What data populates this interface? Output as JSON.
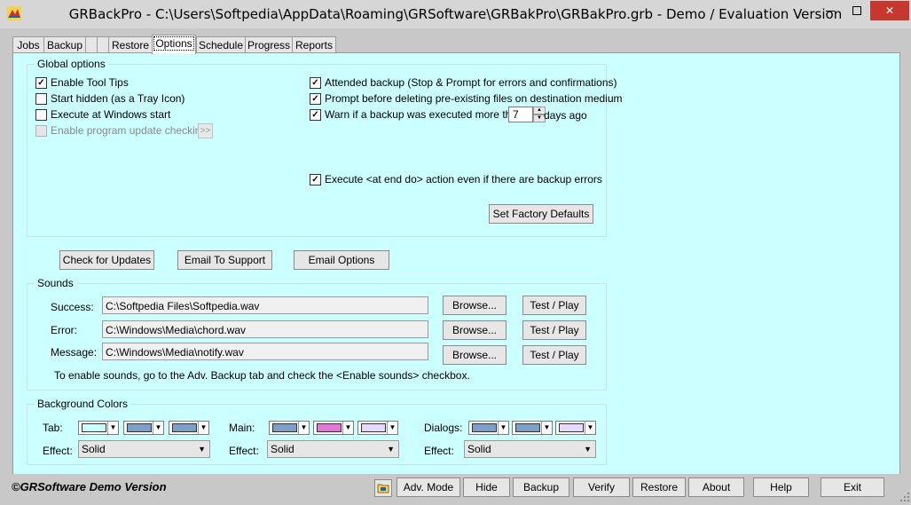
{
  "window": {
    "title": "GRBackPro - C:\\Users\\Softpedia\\AppData\\Roaming\\GRSoftware\\GRBakPro\\GRBakPro.grb - Demo / Evaluation Version",
    "minimize_icon": "minimize-icon",
    "maximize_icon": "maximize-icon",
    "close_glyph": "✕"
  },
  "tabs": [
    "Jobs",
    "Backup",
    "",
    "Restore",
    "Options",
    "Schedule",
    "Progress",
    "Reports"
  ],
  "global_options": {
    "label": "Global options",
    "enable_tool_tips": {
      "label": "Enable Tool Tips",
      "checked": true
    },
    "start_hidden": {
      "label": "Start hidden (as a Tray Icon)",
      "checked": false
    },
    "execute_at_start": {
      "label": "Execute at Windows start",
      "checked": false
    },
    "enable_update_check": {
      "label": "Enable program update checking",
      "checked": false,
      "disabled": true
    },
    "update_more": ">>",
    "attended_backup": {
      "label": "Attended backup (Stop & Prompt for errors and confirmations)",
      "checked": true
    },
    "prompt_delete": {
      "label": "Prompt before deleting pre-existing files on destination medium",
      "checked": true
    },
    "warn_backup": {
      "label": "Warn if a backup was executed more than",
      "checked": true
    },
    "warn_days_value": "7",
    "warn_days_suffix": "days ago",
    "execute_at_end": {
      "label": "Execute <at end do> action even if there are backup errors",
      "checked": true
    },
    "factory_defaults": "Set Factory Defaults"
  },
  "actions": {
    "check_updates": "Check for Updates",
    "email_support": "Email To Support",
    "email_options": "Email Options"
  },
  "sounds": {
    "label": "Sounds",
    "rows": [
      {
        "label": "Success:",
        "path": "C:\\Softpedia Files\\Softpedia.wav",
        "browse": "Browse...",
        "test": "Test / Play"
      },
      {
        "label": "Error:",
        "path": "C:\\Windows\\Media\\chord.wav",
        "browse": "Browse...",
        "test": "Test / Play"
      },
      {
        "label": "Message:",
        "path": "C:\\Windows\\Media\\notify.wav",
        "browse": "Browse...",
        "test": "Test / Play"
      }
    ],
    "hint": "To enable sounds, go to the Adv. Backup tab and check the <Enable sounds> checkbox."
  },
  "background_colors": {
    "label": "Background Colors",
    "tab_label": "Tab:",
    "main_label": "Main:",
    "dialogs_label": "Dialogs:",
    "effect_label": "Effect:",
    "effect_value": "Solid",
    "tab_colors": [
      "#ccffff",
      "#7b9fc8",
      "#7b9fc8"
    ],
    "main_colors": [
      "#7b9fc8",
      "#e07ad6",
      "#e7d8ff"
    ],
    "dialog_colors": [
      "#7b9fc8",
      "#7b9fc8",
      "#e7d8ff"
    ]
  },
  "bottom": {
    "brand": "©GRSoftware Demo Version",
    "brand_icon": "folder-icon",
    "adv_mode": "Adv. Mode",
    "hide": "Hide",
    "backup": "Backup",
    "verify": "Verify",
    "restore": "Restore",
    "about": "About",
    "help": "Help",
    "exit": "Exit"
  }
}
